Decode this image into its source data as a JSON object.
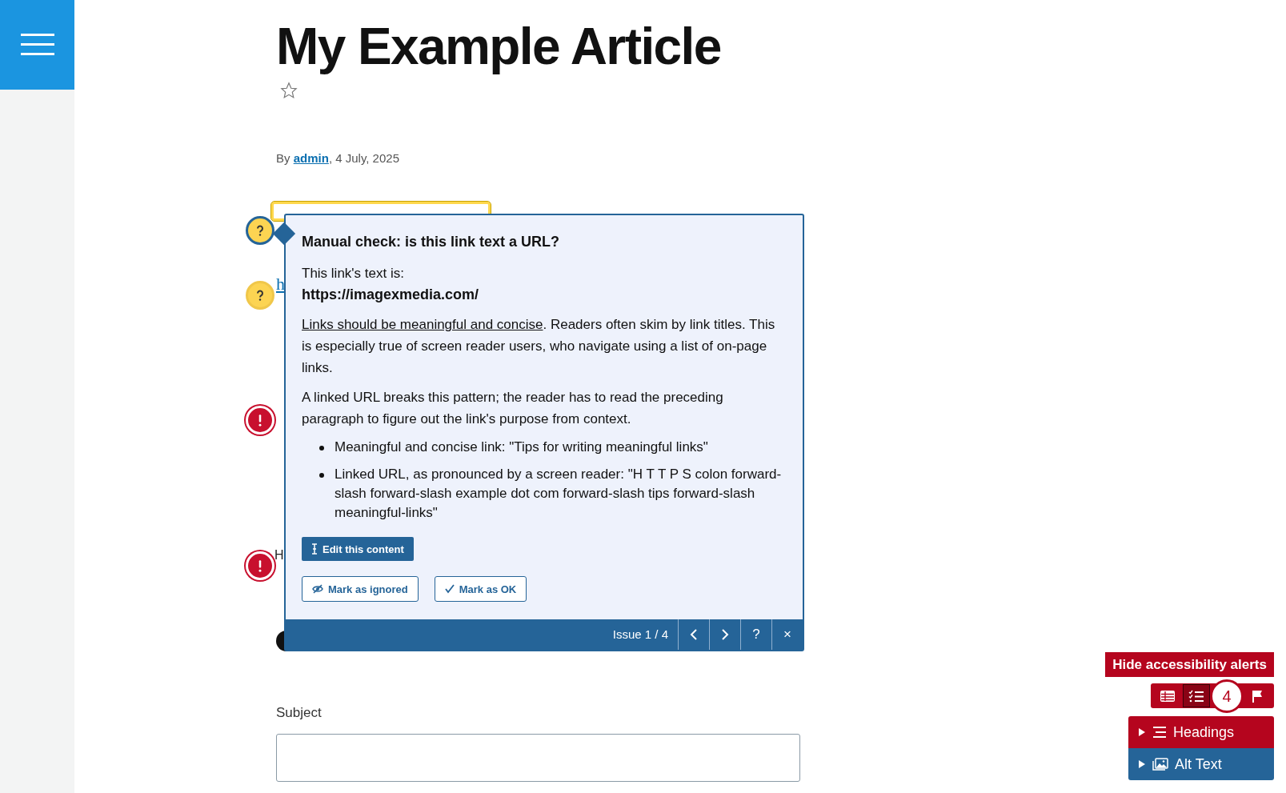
{
  "article": {
    "title": "My Example Article",
    "starred": false,
    "byline": {
      "prefix": "By ",
      "author": "admin",
      "suffix": ", 4 July, 2025"
    },
    "link_fragment": "h",
    "text_fragment": "H"
  },
  "markers": [
    {
      "kind": "question",
      "selected": true
    },
    {
      "kind": "question",
      "selected": false
    },
    {
      "kind": "error",
      "selected": false
    },
    {
      "kind": "error",
      "selected": false
    }
  ],
  "popup": {
    "heading": "Manual check: is this link text a URL?",
    "intro": "This link's text is:",
    "url": "https://imagexmedia.com/",
    "paragraph_link": "Links should be meaningful and concise",
    "paragraph_rest": ". Readers often skim by link titles. This is especially true of screen reader users, who navigate using a list of on-page links.",
    "paragraph_2": "A linked URL breaks this pattern; the reader has to read the preceding paragraph to figure out the link's purpose from context.",
    "bullets": [
      "Meaningful and concise link: \"Tips for writing meaningful links\"",
      "Linked URL, as pronounced by a screen reader: \"H T T P S colon forward-slash forward-slash example dot com forward-slash tips forward-slash meaningful-links\""
    ],
    "edit_button": "Edit this content",
    "ignore_button": "Mark as ignored",
    "ok_button": "Mark as OK",
    "counter": "Issue 1 / 4",
    "help_button": "?",
    "close_button": "×"
  },
  "form": {
    "label": "Subject"
  },
  "toolbar": {
    "hide_button": "Hide accessibility alerts",
    "count": "4",
    "tools": [
      {
        "kind": "table",
        "selected": false
      },
      {
        "kind": "checklist",
        "selected": true
      },
      {
        "kind": "flag",
        "selected": false
      }
    ]
  },
  "panel": {
    "items": [
      {
        "kind": "headings",
        "label": "Headings",
        "expanded": false
      },
      {
        "kind": "alt",
        "label": "Alt Text",
        "expanded": false
      }
    ]
  }
}
